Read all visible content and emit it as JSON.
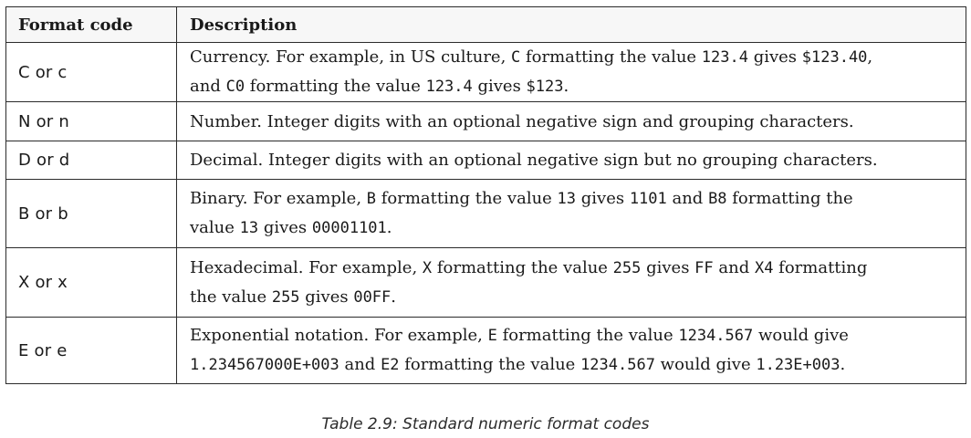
{
  "table": {
    "headers": [
      "Format code",
      "Description"
    ],
    "rows": [
      {
        "code": "C or c",
        "desc": [
          "Currency. For example, in US culture, ",
          {
            "m": "C"
          },
          " formatting the value ",
          {
            "m": "123.4"
          },
          " gives ",
          {
            "m": "$123.40"
          },
          ",\nand ",
          {
            "m": "C0"
          },
          " formatting the value ",
          {
            "m": "123.4"
          },
          " gives ",
          {
            "m": "$123"
          },
          "."
        ]
      },
      {
        "code": "N or n",
        "desc": [
          "Number. Integer digits with an optional negative sign and grouping characters."
        ]
      },
      {
        "code": "D or d",
        "desc": [
          "Decimal. Integer digits with an optional negative sign but no grouping characters."
        ]
      },
      {
        "code": "B or b",
        "desc": [
          "Binary. For example, ",
          {
            "m": "B"
          },
          " formatting the value ",
          {
            "m": "13"
          },
          " gives ",
          {
            "m": "1101"
          },
          " and ",
          {
            "m": "B8"
          },
          " formatting the\nvalue ",
          {
            "m": "13"
          },
          " gives ",
          {
            "m": "00001101"
          },
          "."
        ]
      },
      {
        "code": "X or x",
        "desc": [
          "Hexadecimal. For example, ",
          {
            "m": "X"
          },
          " formatting the value ",
          {
            "m": "255"
          },
          " gives ",
          {
            "m": "FF"
          },
          " and ",
          {
            "m": "X4"
          },
          " formatting\nthe value ",
          {
            "m": "255"
          },
          " gives ",
          {
            "m": "00FF"
          },
          "."
        ]
      },
      {
        "code": "E or e",
        "desc": [
          "Exponential notation. For example, ",
          {
            "m": "E"
          },
          " formatting the value ",
          {
            "m": "1234.567"
          },
          " would give\n",
          {
            "m": "1.234567000E+003"
          },
          " and ",
          {
            "m": "E2"
          },
          " formatting the value ",
          {
            "m": "1234.567"
          },
          " would give ",
          {
            "m": "1.23E+003"
          },
          "."
        ]
      }
    ]
  },
  "caption": "Table 2.9: Standard numeric format codes"
}
